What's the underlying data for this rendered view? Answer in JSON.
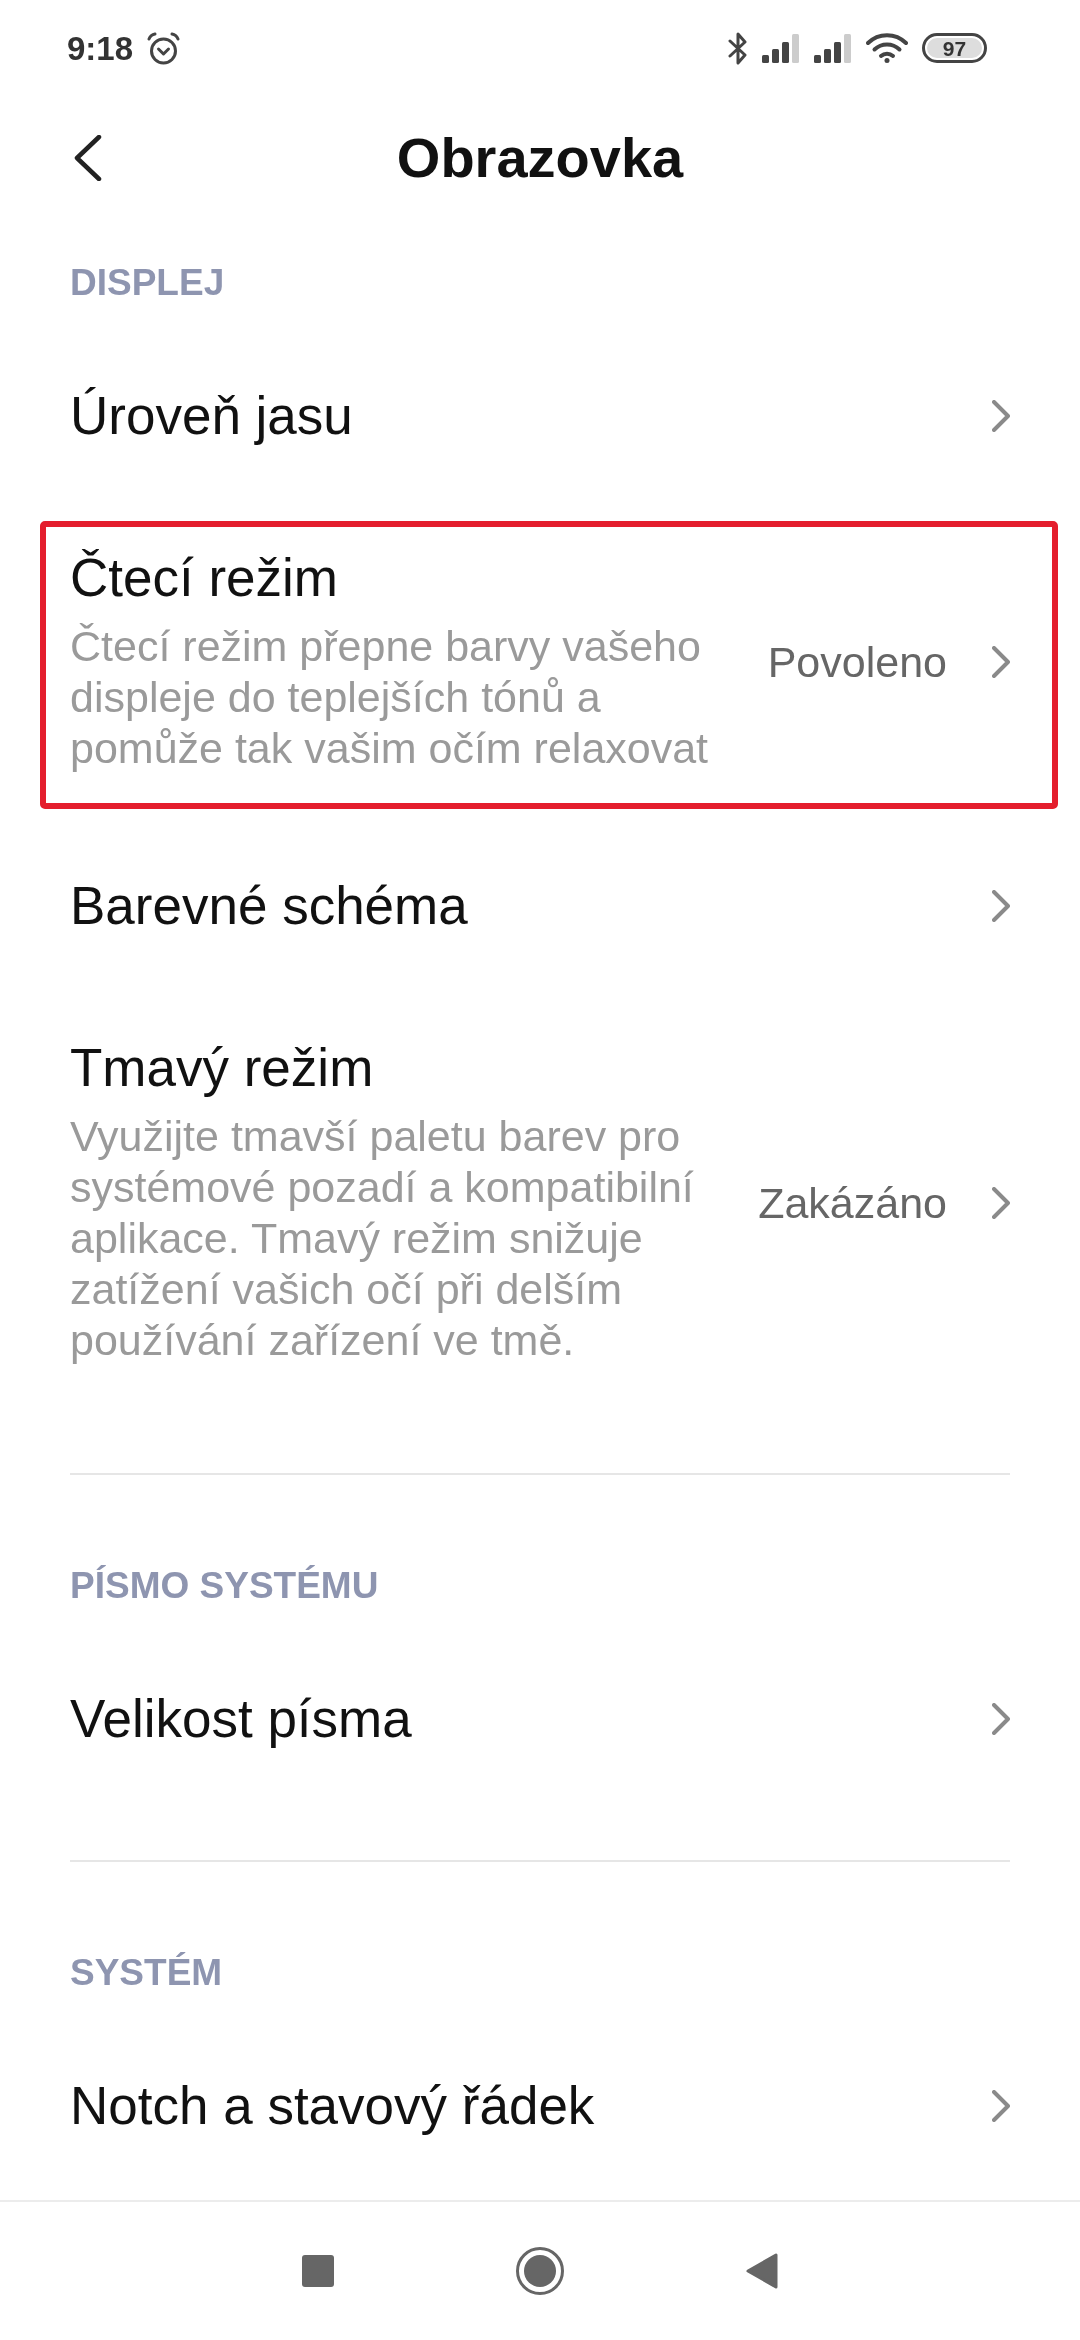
{
  "status_bar": {
    "time": "9:18",
    "battery": "97"
  },
  "header": {
    "title": "Obrazovka"
  },
  "sections": [
    {
      "title": "DISPLEJ",
      "items": [
        {
          "title": "Úroveň jasu",
          "highlighted": false
        },
        {
          "title": "Čtecí režim",
          "description": "Čtecí režim přepne barvy vašeho displeje do teplejších tónů a pomůže tak vašim očím relaxovat",
          "value": "Povoleno",
          "highlighted": true
        },
        {
          "title": "Barevné schéma",
          "highlighted": false
        },
        {
          "title": "Tmavý režim",
          "description": "Využijte tmavší paletu barev pro systémové pozadí a kompatibilní aplikace. Tmavý režim snižuje zatížení vašich očí při delším používání zařízení ve tmě.",
          "value": "Zakázáno",
          "highlighted": false
        }
      ]
    },
    {
      "title": "PÍSMO SYSTÉMU",
      "items": [
        {
          "title": "Velikost písma",
          "highlighted": false
        }
      ]
    },
    {
      "title": "SYSTÉM",
      "items": [
        {
          "title": "Notch a stavový řádek",
          "highlighted": false
        }
      ]
    }
  ]
}
